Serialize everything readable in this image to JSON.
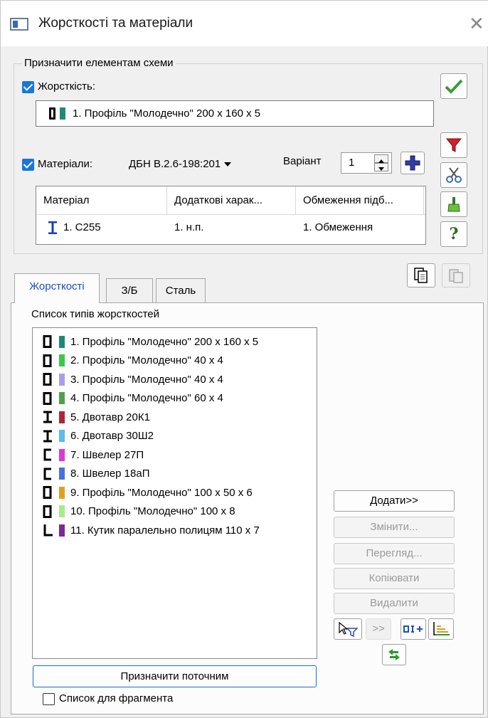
{
  "window": {
    "title": "Жорсткості та матеріали",
    "close_glyph": "✕"
  },
  "assign_group": {
    "legend": "Призначити елементам схеми",
    "stiffness_label": "Жорсткість:",
    "stiffness_checked": true,
    "stiffness_value": "1. Профіль \"Молодечно\" 200 x 160 x 5",
    "stiffness_color": "#1f8a74",
    "materials_label": "Матеріали:",
    "materials_checked": true,
    "norm_value": "ДБН В.2.6-198:201",
    "variant_label": "Варіант",
    "variant_value": "1",
    "table_headers": [
      "Матеріал",
      "Додаткові харак...",
      "Обмеження підб..."
    ],
    "table_row": [
      "1. С255",
      "1. н.п.",
      "1. Обмеження"
    ]
  },
  "icons": {
    "apply": "check-icon",
    "filter": "filter-icon",
    "cut": "scissors-icon",
    "brush": "brush-icon",
    "help": "help-icon",
    "copy": "copy-icon",
    "paste": "paste-icon",
    "add": "plus-icon"
  },
  "help_glyph": "?",
  "tabs": [
    "Жорсткості",
    "З/Б",
    "Сталь"
  ],
  "stiffness_list": {
    "label": "Список типів жорсткостей",
    "items": [
      {
        "text": "1. Профіль \"Молодечно\" 200 x 160 x 5",
        "shape": "box",
        "color": "#1f8a74"
      },
      {
        "text": "2. Профіль \"Молодечно\" 40 x 4",
        "shape": "box",
        "color": "#3cc84a"
      },
      {
        "text": "3. Профіль \"Молодечно\" 40 x 4",
        "shape": "box",
        "color": "#a99cf0"
      },
      {
        "text": "4. Профіль \"Молодечно\" 60 x 4",
        "shape": "box",
        "color": "#4fa04a"
      },
      {
        "text": "5. Двотавр 20К1",
        "shape": "ibeam",
        "color": "#b0243c"
      },
      {
        "text": "6. Двотавр 30Ш2",
        "shape": "ibeam",
        "color": "#5fb8f0"
      },
      {
        "text": "7. Швелер 27П",
        "shape": "channel",
        "color": "#e036d8"
      },
      {
        "text": "8. Швелер 18аП",
        "shape": "channel",
        "color": "#4a6fe0"
      },
      {
        "text": "9. Профіль \"Молодечно\" 100 x 50 x 6",
        "shape": "box",
        "color": "#e0a020"
      },
      {
        "text": "10. Профіль \"Молодечно\" 100 x 8",
        "shape": "box",
        "color": "#a6ec8a"
      },
      {
        "text": "11. Кутик паралельно полицям 110 x 7",
        "shape": "angle",
        "color": "#7a2a9a"
      }
    ]
  },
  "side_buttons": {
    "add": "Додати>>",
    "edit": "Змінити...",
    "view": "Перегляд...",
    "copy": "Копіювати",
    "delete": "Видалити",
    "arrows": ">>"
  },
  "assign_current": "Призначити поточним",
  "fragment_checkbox": "Список для фрагмента"
}
